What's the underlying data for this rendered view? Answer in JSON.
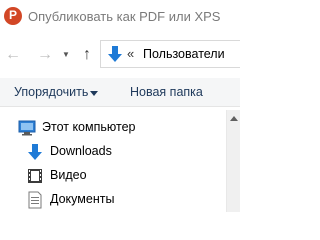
{
  "window": {
    "title": "Опубликовать как PDF или XPS",
    "app_icon": "powerpoint-icon"
  },
  "navigation": {
    "back_icon": "back-arrow-icon",
    "forward_icon": "forward-arrow-icon",
    "recent_icon": "chevron-down-icon",
    "up_icon": "up-arrow-icon",
    "address": {
      "icon": "download-folder-icon",
      "chevrons": "«",
      "text": "Пользователи"
    }
  },
  "toolbar": {
    "organize_label": "Упорядочить",
    "new_folder_label": "Новая папка"
  },
  "tree": {
    "items": [
      {
        "label": "Этот компьютер",
        "icon": "computer-icon"
      },
      {
        "label": "Downloads",
        "icon": "downloads-icon"
      },
      {
        "label": "Видео",
        "icon": "video-icon"
      },
      {
        "label": "Документы",
        "icon": "documents-icon"
      }
    ]
  },
  "colors": {
    "accent_blue": "#1e7ad6",
    "toolbar_text": "#1e395b",
    "title_text": "#7a7a7a",
    "app_icon": "#d24726"
  }
}
